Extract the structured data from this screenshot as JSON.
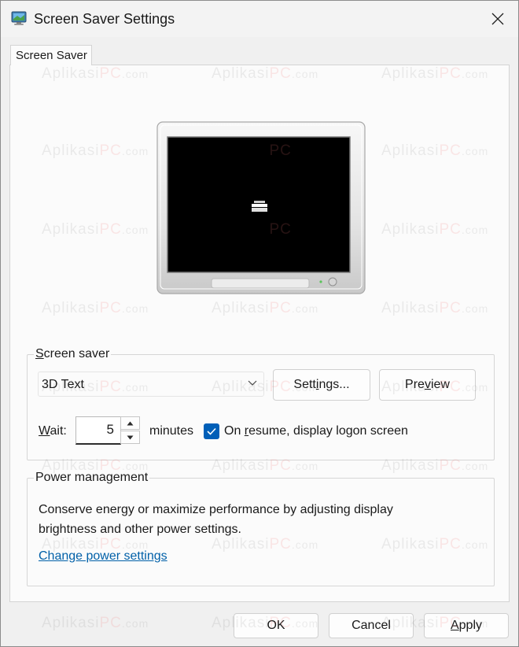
{
  "window": {
    "title": "Screen Saver Settings",
    "icons": {
      "app": "display-settings-icon",
      "close": "close-icon"
    }
  },
  "tabs": [
    {
      "label": "Screen Saver",
      "selected": true
    }
  ],
  "preview": {
    "icons": {
      "monitor": "monitor-icon",
      "screensaver_glyph": "3d-text-glyph-icon"
    }
  },
  "screensaver_group": {
    "label": "Screen saver",
    "selected_option": "3D Text",
    "settings_button": {
      "before": "Sett",
      "mnemonic": "i",
      "after": "ngs..."
    },
    "preview_button": {
      "before": "Pre",
      "mnemonic": "v",
      "after": "iew"
    },
    "wait_label": {
      "mnemonic": "W",
      "after": "ait:"
    },
    "wait_value": "5",
    "wait_units": "minutes",
    "resume_checked": true,
    "resume_label": {
      "before": "On ",
      "mnemonic": "r",
      "after": "esume, display logon screen"
    }
  },
  "power_group": {
    "label": "Power management",
    "description": "Conserve energy or maximize performance by adjusting display brightness and other power settings.",
    "link": "Change power settings"
  },
  "buttons": {
    "ok": "OK",
    "cancel": "Cancel",
    "apply": {
      "mnemonic": "A",
      "after": "pply"
    }
  },
  "watermark": {
    "part1": "Aplikasi",
    "part2": "PC",
    "part3": ".com"
  },
  "colors": {
    "accent": "#005fb8",
    "link": "#0060a8",
    "watermark_pc": "#f07878"
  }
}
